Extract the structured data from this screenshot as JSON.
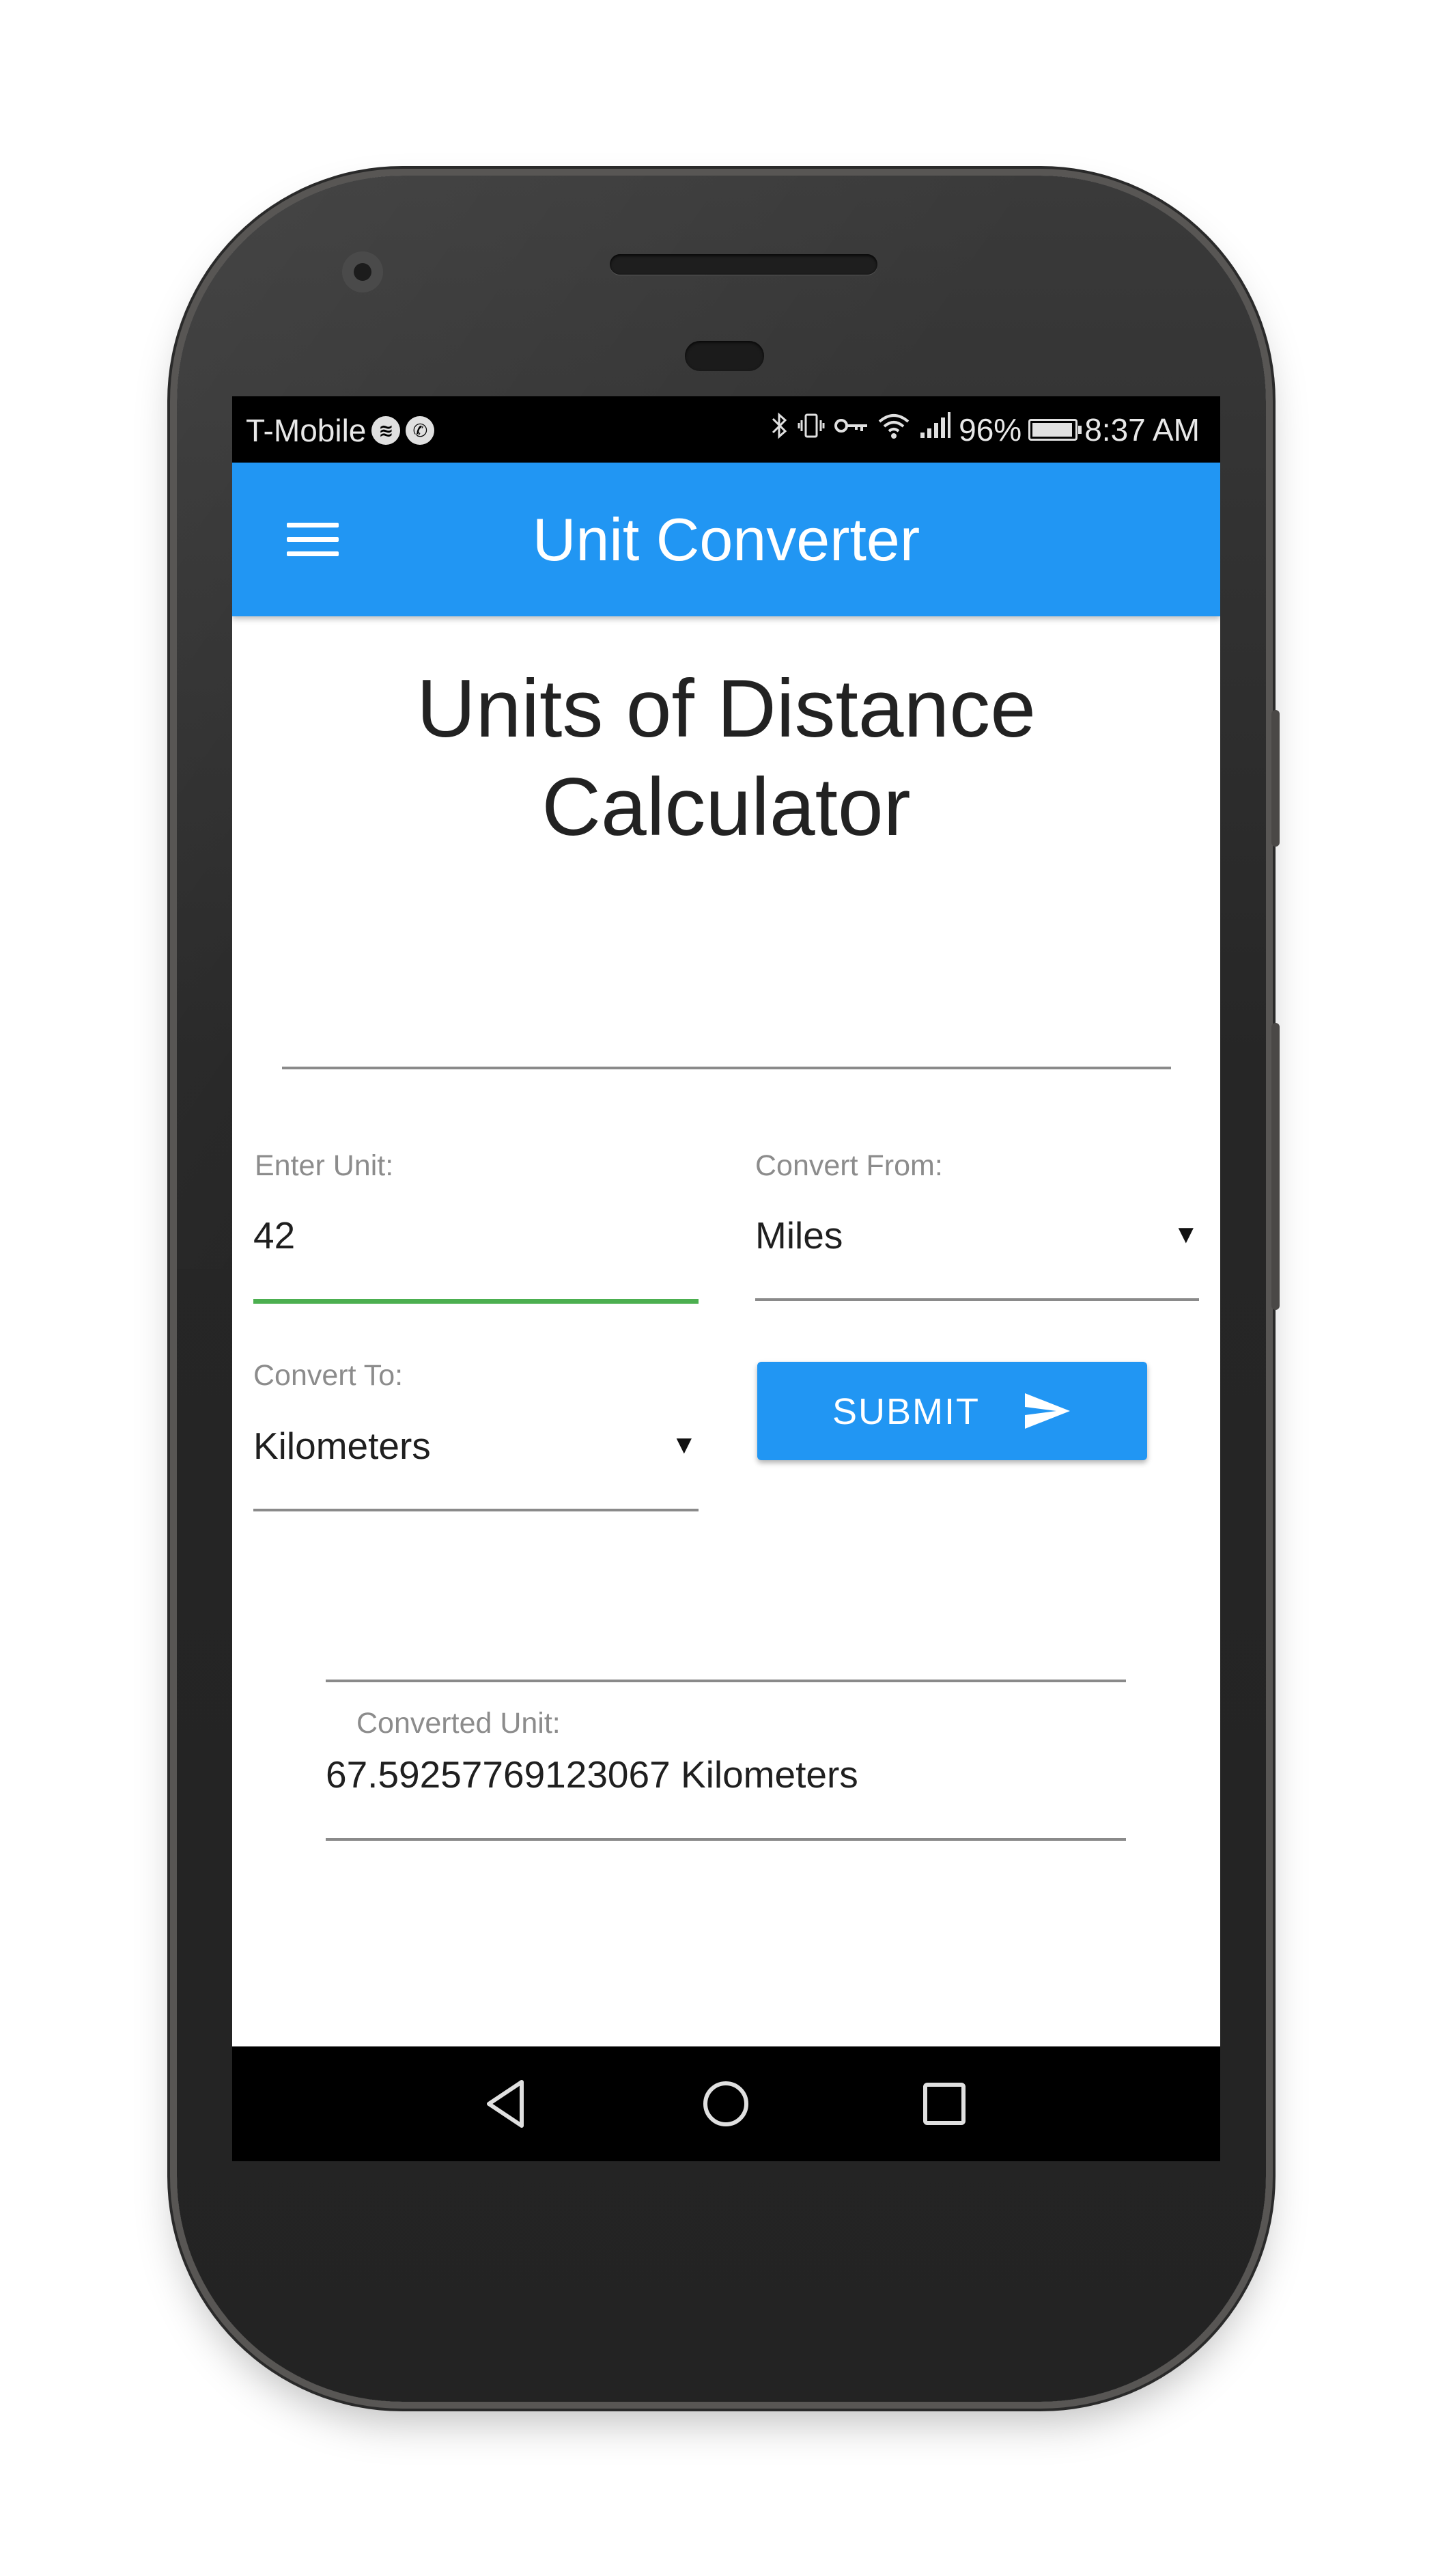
{
  "status_bar": {
    "carrier": "T-Mobile",
    "battery_percent": "96%",
    "battery_level": 0.96,
    "time": "8:37 AM",
    "icons": [
      "spotify-icon",
      "phone-call-icon",
      "bluetooth-icon",
      "vibrate-icon",
      "vpn-key-icon",
      "wifi-icon",
      "signal-icon",
      "battery-icon"
    ]
  },
  "app_bar": {
    "title": "Unit Converter",
    "menu_icon": "hamburger-menu-icon",
    "color": "#2196f3"
  },
  "main": {
    "heading": "Units of Distance Calculator",
    "enter_unit": {
      "label": "Enter Unit:",
      "value": "42"
    },
    "convert_from": {
      "label": "Convert From:",
      "value": "Miles"
    },
    "convert_to": {
      "label": "Convert To:",
      "value": "Kilometers"
    },
    "submit": {
      "label": "SUBMIT",
      "icon": "send-icon"
    },
    "converted": {
      "label": "Converted Unit:",
      "value": "67.59257769123067 Kilometers"
    }
  },
  "accent_colors": {
    "primary": "#2196f3",
    "focus_underline": "#4caf50"
  },
  "nav_bar": {
    "icons": [
      "back-icon",
      "home-icon",
      "recents-icon"
    ]
  }
}
